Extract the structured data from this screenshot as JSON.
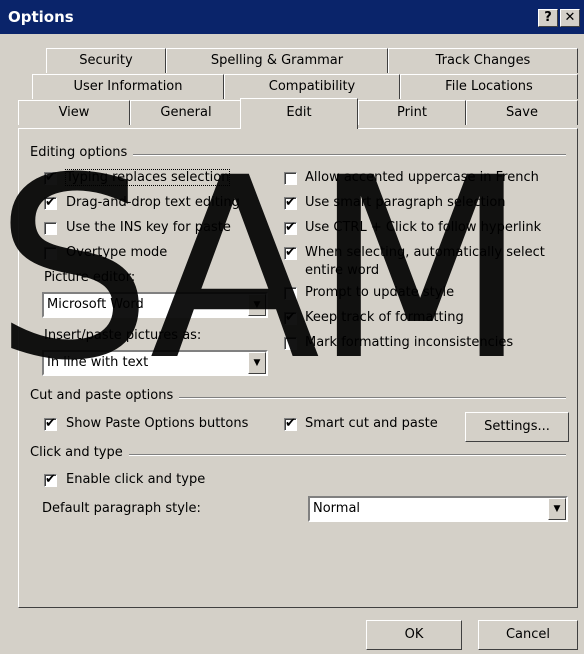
{
  "window": {
    "title": "Options",
    "help_glyph": "?",
    "close_glyph": "✕"
  },
  "tabs_row1": [
    "Security",
    "Spelling & Grammar",
    "Track Changes"
  ],
  "tabs_row2": [
    "User Information",
    "Compatibility",
    "File Locations"
  ],
  "tabs_row3": [
    "View",
    "General",
    "Edit",
    "Print",
    "Save"
  ],
  "active_tab": "Edit",
  "editing": {
    "group_label": "Editing options",
    "left": [
      {
        "label": "Typing replaces selection",
        "checked": true
      },
      {
        "label": "Drag-and-drop text editing",
        "checked": true
      },
      {
        "label": "Use the INS key for paste",
        "checked": false
      },
      {
        "label": "Overtype mode",
        "checked": false
      }
    ],
    "picture_editor_label": "Picture editor:",
    "picture_editor_value": "Microsoft Word",
    "insert_label": "Insert/paste pictures as:",
    "insert_value": "In line with text",
    "right": [
      {
        "label": "Allow accented uppercase in French",
        "checked": false
      },
      {
        "label": "Use smart paragraph selection",
        "checked": true
      },
      {
        "label": "Use CTRL + Click to follow hyperlink",
        "checked": true
      },
      {
        "label": "When selecting, automatically select",
        "label2": "entire word",
        "checked": true
      },
      {
        "label": "Prompt to update style",
        "checked": false
      },
      {
        "label": "Keep track of formatting",
        "checked": true
      },
      {
        "label": "Mark formatting inconsistencies",
        "checked": false
      }
    ]
  },
  "cut_paste": {
    "group_label": "Cut and paste options",
    "show_paste": {
      "label": "Show Paste Options buttons",
      "checked": true
    },
    "smart_cut": {
      "label": "Smart cut and paste",
      "checked": true
    },
    "settings_button": "Settings..."
  },
  "click_type": {
    "group_label": "Click and type",
    "enable": {
      "label": "Enable click and type",
      "checked": true
    },
    "default_style_label": "Default paragraph style:",
    "default_style_value": "Normal"
  },
  "buttons": {
    "ok": "OK",
    "cancel": "Cancel"
  },
  "watermark": "SAM"
}
